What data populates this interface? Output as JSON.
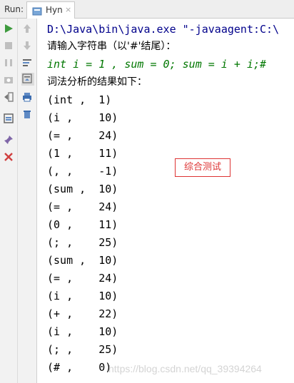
{
  "run_panel": {
    "run_label": "Run:",
    "tab_label": "Hyn",
    "tab_close": "×"
  },
  "console": {
    "command": "D:\\Java\\bin\\java.exe \"-javaagent:C:\\",
    "prompt1": "请输入字符串（以'#'结尾）：",
    "user_input": "int i = 1 , sum = 0; sum = i + i;#",
    "prompt2": "词法分析的结果如下：",
    "tokens": [
      "(int ,  1)",
      "(i ,    10)",
      "(= ,    24)",
      "(1 ,    11)",
      "(, ,    -1)",
      "(sum ,  10)",
      "(= ,    24)",
      "(0 ,    11)",
      "(; ,    25)",
      "(sum ,  10)",
      "(= ,    24)",
      "(i ,    10)",
      "(+ ,    22)",
      "(i ,    10)",
      "(; ,    25)",
      "(# ,    0)"
    ]
  },
  "annotation": "综合测试",
  "watermark": "https://blog.csdn.net/qq_39394264",
  "colors": {
    "command": "#00008b",
    "input": "#007700",
    "annotation": "#d33333",
    "run_green": "#3d9a3d",
    "stop_red": "#d04040"
  },
  "icons": {
    "toolbar1": [
      "rerun-icon",
      "stop-icon",
      "pause-icon",
      "camera-icon",
      "exit-icon",
      "layout-icon",
      "pin-icon",
      "close-icon"
    ],
    "toolbar2": [
      "up-arrow-icon",
      "down-arrow-icon",
      "wrap-icon",
      "scroll-end-icon",
      "print-icon",
      "trash-icon"
    ]
  }
}
